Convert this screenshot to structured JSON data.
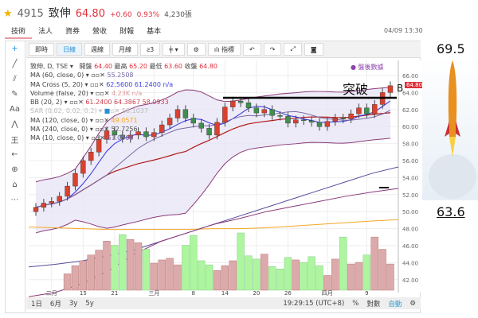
{
  "header": {
    "code": "4915",
    "name": "致伸",
    "price": "64.80",
    "change": "+0.60",
    "pct": "0.93%",
    "volume": "4,230張",
    "time": "04/09 13:30"
  },
  "tabs": [
    "技術",
    "法人",
    "資券",
    "營收",
    "財報",
    "基本"
  ],
  "toolbar": {
    "items": [
      "即時",
      "日線",
      "週線",
      "月線",
      "指標"
    ]
  },
  "legend": {
    "main": "致伸, D, TSE",
    "ohlc_labels": [
      "開盤",
      "最高",
      "最低",
      "收盤"
    ],
    "ohlc": [
      "64.40",
      "65.20",
      "63.60",
      "64.80"
    ],
    "rows": [
      [
        "MA (60, close, 0)",
        "55.2508"
      ],
      [
        "MA Cross (5, 20)",
        "62.5600 61.2400 n/a"
      ],
      [
        "Volume (false, 20)",
        "4.23K n/a"
      ],
      [
        "BB (20, 2)",
        "61.2400 64.3867 58.0933"
      ],
      [
        "SAR (0.02, 0.02, 0.2)",
        "58.1037"
      ],
      [
        "MA (120, close, 0)",
        "49.0571"
      ],
      [
        "MA (240, close, 0)",
        "52.7256"
      ],
      [
        "MA (10, close, 0)",
        "61.0900"
      ]
    ]
  },
  "after_hours": "盤後數據",
  "annotation": {
    "text": "突破",
    "mark": "B"
  },
  "price_tag": "64.80",
  "chart_data": {
    "type": "candlestick",
    "ylim": [
      41,
      67
    ],
    "yticks": [
      "66.00",
      "64.00",
      "62.00",
      "60.00",
      "58.00",
      "56.00",
      "54.00",
      "52.00",
      "50.00",
      "48.00",
      "46.00",
      "44.00",
      "42.00"
    ],
    "xticks": [
      {
        "i": 2,
        "label": "二月"
      },
      {
        "i": 6,
        "label": "15"
      },
      {
        "i": 10,
        "label": "21"
      },
      {
        "i": 15,
        "label": "三月"
      },
      {
        "i": 20,
        "label": "8"
      },
      {
        "i": 24,
        "label": "14"
      },
      {
        "i": 28,
        "label": "20"
      },
      {
        "i": 32,
        "label": "26"
      },
      {
        "i": 37,
        "label": "四月"
      },
      {
        "i": 42,
        "label": "9"
      }
    ],
    "closes": [
      50.5,
      51,
      51.2,
      51.8,
      53,
      54.5,
      56,
      57,
      58.5,
      59.5,
      59,
      58.6,
      59,
      59.4,
      58.8,
      59.3,
      60.2,
      61,
      62,
      61,
      60.4,
      59.8,
      59,
      60.5,
      62.3,
      63,
      62.8,
      62.2,
      61.6,
      62,
      61.3,
      61.2,
      60.4,
      60.8,
      60.7,
      60.5,
      60,
      60.6,
      61,
      60.9,
      61.5,
      62.2,
      61.5,
      62.6,
      64,
      64.8
    ],
    "volume": [
      2,
      3,
      3.6,
      4.3,
      4.9,
      6,
      5.5,
      6.8,
      6.2,
      5.8,
      5,
      3.3,
      3.7,
      3.9,
      3.1,
      5.5,
      6.7,
      3.6,
      3.1,
      2.4,
      3,
      3.6,
      7,
      4.2,
      3.8,
      4.4,
      2.9,
      2.6,
      4,
      3.7,
      3.4,
      4.1,
      3,
      1.8,
      3.8,
      6.5,
      3.2,
      3.4,
      4.3,
      6.5,
      5,
      3.2
    ],
    "ma60": [
      43.5,
      43.8,
      44.2,
      44.8,
      45.5,
      46.5,
      47.5,
      48.5,
      49.5,
      50.5,
      51.5,
      52.5,
      53.5,
      54.5,
      55.25
    ],
    "ma120": [
      48.2,
      48.1,
      48,
      47.9,
      47.9,
      47.9,
      47.9,
      48,
      48,
      48.1,
      48.3,
      48.5,
      48.7,
      48.9,
      49.06
    ],
    "ma240": [
      40,
      40.5,
      41.5,
      43,
      45,
      46.5,
      47.5,
      48.5,
      49.2,
      50,
      50.6,
      51.2,
      51.8,
      52.3,
      52.73
    ]
  },
  "bottom": {
    "ranges": [
      "1日",
      "6月",
      "3y",
      "5y"
    ],
    "clock": "19:29:15 (UTC+8)",
    "pct": "%",
    "log": "對數",
    "auto": "自動"
  },
  "rocket": {
    "top": "69.5",
    "bottom": "63.6"
  }
}
